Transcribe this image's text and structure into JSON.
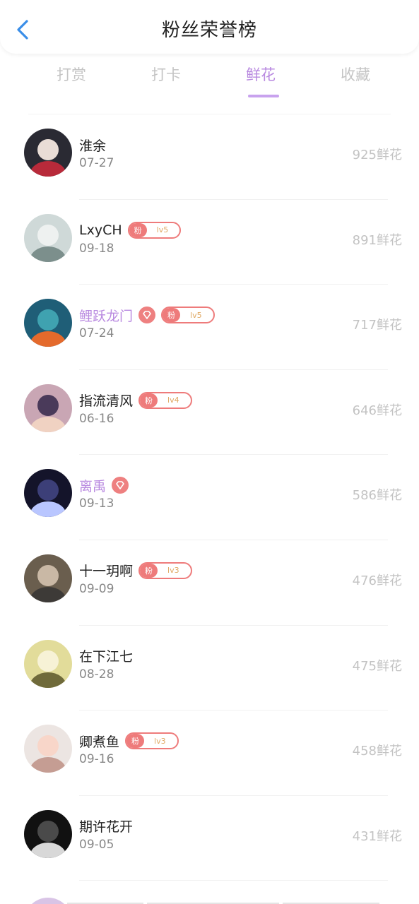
{
  "header": {
    "title": "粉丝荣誉榜",
    "back_icon": "chevron-left-icon"
  },
  "tabs": [
    {
      "label": "打赏",
      "active": false
    },
    {
      "label": "打卡",
      "active": false
    },
    {
      "label": "鲜花",
      "active": true
    },
    {
      "label": "收藏",
      "active": false
    }
  ],
  "colors": {
    "accent": "#b98ae0",
    "badge": "#ee7b7b",
    "back": "#3a8ee8"
  },
  "rows": [
    {
      "name": "淮余",
      "date": "07-27",
      "count": "925鲜花",
      "vip": false,
      "gem": false,
      "badge": null
    },
    {
      "name": "LxyCH",
      "date": "09-18",
      "count": "891鲜花",
      "vip": false,
      "gem": false,
      "badge": {
        "label": "粉",
        "level": "lv5"
      }
    },
    {
      "name": "鲤跃龙门",
      "date": "07-24",
      "count": "717鲜花",
      "vip": true,
      "gem": true,
      "badge": {
        "label": "粉",
        "level": "lv5"
      }
    },
    {
      "name": "指流清风",
      "date": "06-16",
      "count": "646鲜花",
      "vip": false,
      "gem": false,
      "badge": {
        "label": "粉",
        "level": "lv4"
      }
    },
    {
      "name": "离禹",
      "date": "09-13",
      "count": "586鲜花",
      "vip": true,
      "gem": true,
      "badge": null
    },
    {
      "name": "十一玥啊",
      "date": "09-09",
      "count": "476鲜花",
      "vip": false,
      "gem": false,
      "badge": {
        "label": "粉",
        "level": "lv3"
      }
    },
    {
      "name": "在下江七",
      "date": "08-28",
      "count": "475鲜花",
      "vip": false,
      "gem": false,
      "badge": null
    },
    {
      "name": "卿煮鱼",
      "date": "09-16",
      "count": "458鲜花",
      "vip": false,
      "gem": false,
      "badge": {
        "label": "粉",
        "level": "lv3"
      }
    },
    {
      "name": "期许花开",
      "date": "09-05",
      "count": "431鲜花",
      "vip": false,
      "gem": false,
      "badge": null
    }
  ]
}
